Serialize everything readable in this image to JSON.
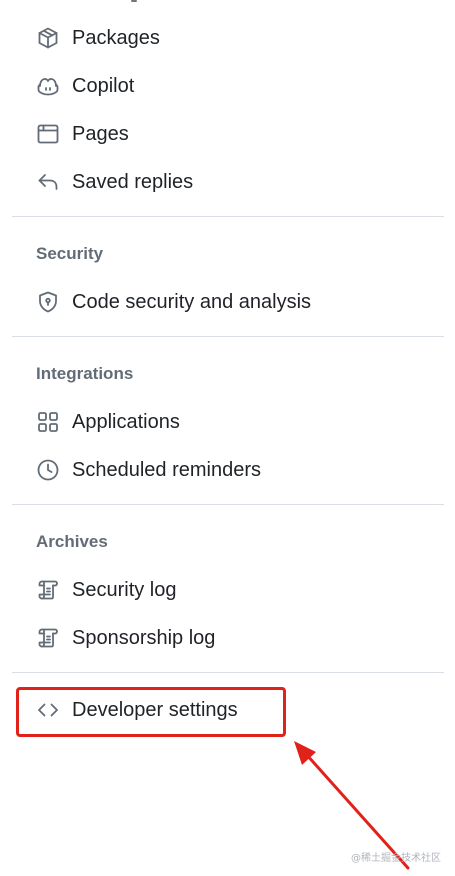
{
  "menu": {
    "items_top": [
      {
        "label": "Packages",
        "icon": "package-icon"
      },
      {
        "label": "Copilot",
        "icon": "copilot-icon"
      },
      {
        "label": "Pages",
        "icon": "browser-icon"
      },
      {
        "label": "Saved replies",
        "icon": "reply-icon"
      }
    ],
    "security": {
      "title": "Security",
      "items": [
        {
          "label": "Code security and analysis",
          "icon": "shield-lock-icon"
        }
      ]
    },
    "integrations": {
      "title": "Integrations",
      "items": [
        {
          "label": "Applications",
          "icon": "apps-icon"
        },
        {
          "label": "Scheduled reminders",
          "icon": "clock-icon"
        }
      ]
    },
    "archives": {
      "title": "Archives",
      "items": [
        {
          "label": "Security log",
          "icon": "log-icon"
        },
        {
          "label": "Sponsorship log",
          "icon": "log-icon"
        }
      ]
    },
    "developer": {
      "label": "Developer settings",
      "icon": "code-icon"
    }
  },
  "annotation": {
    "highlight_color": "#e0221b"
  },
  "watermark": {
    "text": "@稀土掘金技术社区"
  }
}
